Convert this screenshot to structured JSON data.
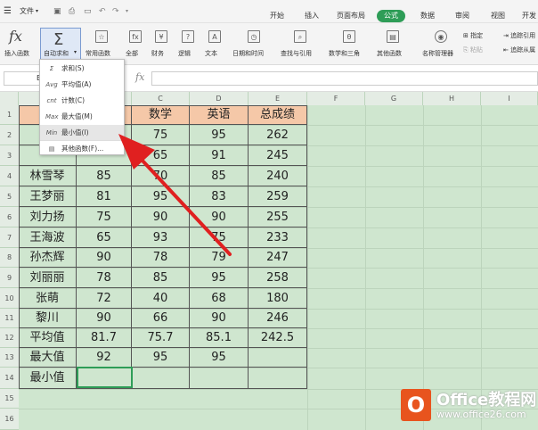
{
  "menubar": {
    "file_label": "文件",
    "tabs": [
      "开始",
      "插入",
      "页面布局",
      "公式",
      "数据",
      "审阅",
      "视图",
      "开发"
    ],
    "active_tab": "公式"
  },
  "ribbon": {
    "insert_function": "插入函数",
    "insert_function_symbol": "fx",
    "autosum": "自动求和",
    "groups": [
      "常用函数",
      "全部",
      "财务",
      "逻辑",
      "文本",
      "日期和时间",
      "查找与引用",
      "数学和三角",
      "其他函数",
      "名称管理器"
    ],
    "right_items": [
      "指定",
      "粘贴",
      "追踪引用",
      "追踪从属"
    ]
  },
  "formula_bar": {
    "fx_symbol": "fx",
    "namebox_value": "B"
  },
  "columns": [
    "C",
    "D",
    "E",
    "F",
    "G",
    "H",
    "I"
  ],
  "rows": [
    "1",
    "2",
    "3",
    "4",
    "5",
    "6",
    "7",
    "8",
    "9",
    "10",
    "11",
    "12",
    "13",
    "14",
    "15",
    "16"
  ],
  "table": {
    "headers": [
      "数学",
      "英语",
      "总成绩"
    ],
    "rows": [
      {
        "name": "",
        "b": "",
        "math": "75",
        "eng": "95",
        "total": "262"
      },
      {
        "name": "",
        "b": "",
        "math": "65",
        "eng": "91",
        "total": "245"
      },
      {
        "name": "林雪琴",
        "b": "85",
        "math": "70",
        "eng": "85",
        "total": "240"
      },
      {
        "name": "王梦丽",
        "b": "81",
        "math": "95",
        "eng": "83",
        "total": "259"
      },
      {
        "name": "刘力扬",
        "b": "75",
        "math": "90",
        "eng": "90",
        "total": "255"
      },
      {
        "name": "王海波",
        "b": "65",
        "math": "93",
        "eng": "75",
        "total": "233"
      },
      {
        "name": "孙杰辉",
        "b": "90",
        "math": "78",
        "eng": "79",
        "total": "247"
      },
      {
        "name": "刘丽丽",
        "b": "78",
        "math": "85",
        "eng": "95",
        "total": "258"
      },
      {
        "name": "张萌",
        "b": "72",
        "math": "40",
        "eng": "68",
        "total": "180"
      },
      {
        "name": "黎川",
        "b": "90",
        "math": "66",
        "eng": "90",
        "total": "246"
      },
      {
        "name": "平均值",
        "b": "81.7",
        "math": "75.7",
        "eng": "85.1",
        "total": "242.5"
      },
      {
        "name": "最大值",
        "b": "92",
        "math": "95",
        "eng": "95",
        "total": ""
      },
      {
        "name": "最小值",
        "b": "",
        "math": "",
        "eng": "",
        "total": ""
      }
    ]
  },
  "dropdown": {
    "items": [
      {
        "icon": "Σ",
        "label": "求和(S)"
      },
      {
        "icon": "Avg",
        "label": "平均值(A)"
      },
      {
        "icon": "cnt",
        "label": "计数(C)"
      },
      {
        "icon": "Max",
        "label": "最大值(M)"
      },
      {
        "icon": "Min",
        "label": "最小值(I)"
      },
      {
        "icon": "▤",
        "label": "其他函数(F)..."
      }
    ],
    "highlighted_index": 4
  },
  "watermark": {
    "brand": "Office教程网",
    "url": "www.office26.com"
  },
  "colors": {
    "accent": "#2e9d57",
    "grid_bg": "#cfe6cf",
    "header_fill": "#f5c8a8",
    "arrow": "#e02020"
  }
}
